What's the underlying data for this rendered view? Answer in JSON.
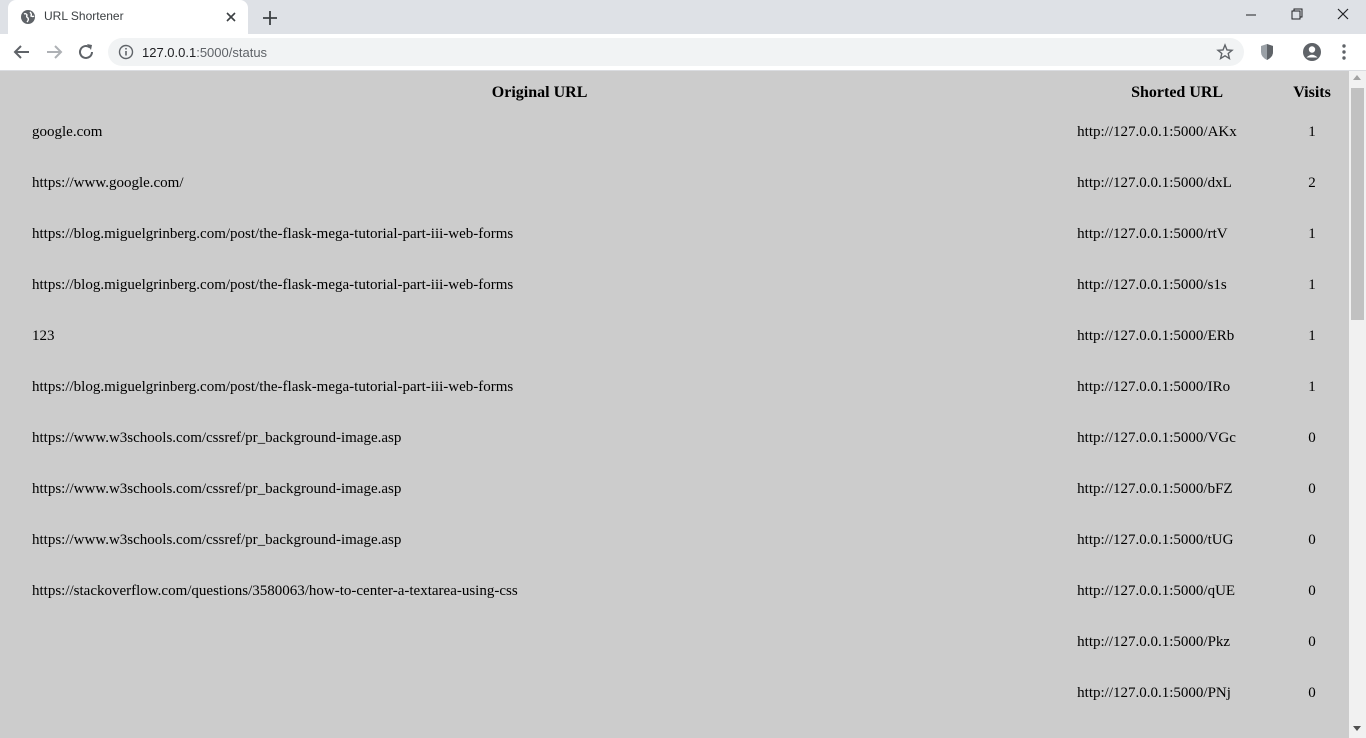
{
  "browser": {
    "tab": {
      "title": "URL Shortener",
      "favicon": "globe-icon"
    },
    "address": {
      "host": "127.0.0.1",
      "port_and_path": ":5000/status"
    },
    "icons": [
      "back-icon",
      "forward-icon",
      "reload-icon",
      "info-icon",
      "star-icon",
      "extension-shield-icon",
      "profile-icon",
      "menu-icon",
      "minimize-icon",
      "restore-icon",
      "close-window-icon",
      "new-tab-icon"
    ]
  },
  "table": {
    "headers": {
      "original": "Original URL",
      "shorted": "Shorted URL",
      "visits": "Visits"
    },
    "rows": [
      {
        "original": "google.com",
        "shorted": "http://127.0.0.1:5000/AKx",
        "visits": "1"
      },
      {
        "original": "https://www.google.com/",
        "shorted": "http://127.0.0.1:5000/dxL",
        "visits": "2"
      },
      {
        "original": "https://blog.miguelgrinberg.com/post/the-flask-mega-tutorial-part-iii-web-forms",
        "shorted": "http://127.0.0.1:5000/rtV",
        "visits": "1"
      },
      {
        "original": "https://blog.miguelgrinberg.com/post/the-flask-mega-tutorial-part-iii-web-forms",
        "shorted": "http://127.0.0.1:5000/s1s",
        "visits": "1"
      },
      {
        "original": "123",
        "shorted": "http://127.0.0.1:5000/ERb",
        "visits": "1"
      },
      {
        "original": "https://blog.miguelgrinberg.com/post/the-flask-mega-tutorial-part-iii-web-forms",
        "shorted": "http://127.0.0.1:5000/IRo",
        "visits": "1"
      },
      {
        "original": "https://www.w3schools.com/cssref/pr_background-image.asp",
        "shorted": "http://127.0.0.1:5000/VGc",
        "visits": "0"
      },
      {
        "original": "https://www.w3schools.com/cssref/pr_background-image.asp",
        "shorted": "http://127.0.0.1:5000/bFZ",
        "visits": "0"
      },
      {
        "original": "https://www.w3schools.com/cssref/pr_background-image.asp",
        "shorted": "http://127.0.0.1:5000/tUG",
        "visits": "0"
      },
      {
        "original": "https://stackoverflow.com/questions/3580063/how-to-center-a-textarea-using-css",
        "shorted": "http://127.0.0.1:5000/qUE",
        "visits": "0"
      },
      {
        "original": "",
        "shorted": "http://127.0.0.1:5000/Pkz",
        "visits": "0"
      },
      {
        "original": "",
        "shorted": "http://127.0.0.1:5000/PNj",
        "visits": "0"
      }
    ]
  },
  "colors": {
    "page_background": "#cccccc",
    "tabstrip": "#dee1e6",
    "toolbar": "#ffffff",
    "omnibox": "#f1f3f4"
  }
}
